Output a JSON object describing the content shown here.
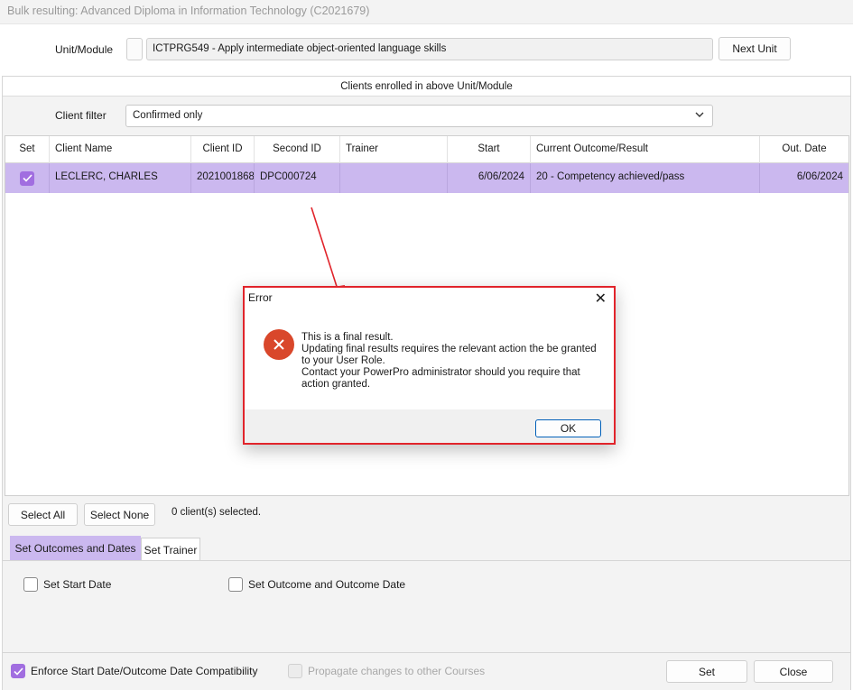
{
  "window": {
    "title": "Bulk resulting: Advanced Diploma in Information Technology (C2021679)"
  },
  "unit": {
    "label": "Unit/Module",
    "value": "ICTPRG549 - Apply intermediate object-oriented language skills",
    "next_button": "Next Unit"
  },
  "clients_section": {
    "header": "Clients enrolled in above Unit/Module"
  },
  "filter": {
    "label": "Client filter",
    "value": "Confirmed only"
  },
  "grid": {
    "columns": [
      "Set",
      "Client Name",
      "Client ID",
      "Second ID",
      "Trainer",
      "Start",
      "Current Outcome/Result",
      "Out. Date"
    ],
    "rows": [
      {
        "checked": true,
        "client_name": "LECLERC, CHARLES",
        "client_id": "2021001868",
        "second_id": "DPC000724",
        "trainer": "",
        "start": "6/06/2024",
        "outcome": "20 - Competency achieved/pass",
        "out_date": "6/06/2024"
      }
    ]
  },
  "selection": {
    "select_all": "Select All",
    "select_none": "Select None",
    "count_text": "0 client(s) selected."
  },
  "tabs": [
    {
      "label": "Set Outcomes and Dates",
      "active": true
    },
    {
      "label": "Set Trainer",
      "active": false
    }
  ],
  "options": {
    "set_start_date": "Set Start Date",
    "set_outcome": "Set Outcome and Outcome Date"
  },
  "footer": {
    "enforce_label": "Enforce Start Date/Outcome Date Compatibility",
    "enforce_checked": true,
    "propagate_label": "Propagate changes to other Courses",
    "propagate_checked": false,
    "set_button": "Set",
    "close_button": "Close"
  },
  "dialog": {
    "title": "Error",
    "icon": "error-icon",
    "lines": [
      "This is a final result.",
      "Updating final results requires the relevant action the be granted to your User Role.",
      "Contact your PowerPro administrator should you require that action granted."
    ],
    "ok_button": "OK"
  },
  "colors": {
    "selection_purple": "#cbb8ef",
    "checkbox_purple": "#a16ee0",
    "highlight_red": "#e1242b",
    "error_icon": "#d9472b",
    "primary_blue": "#005fb8"
  }
}
